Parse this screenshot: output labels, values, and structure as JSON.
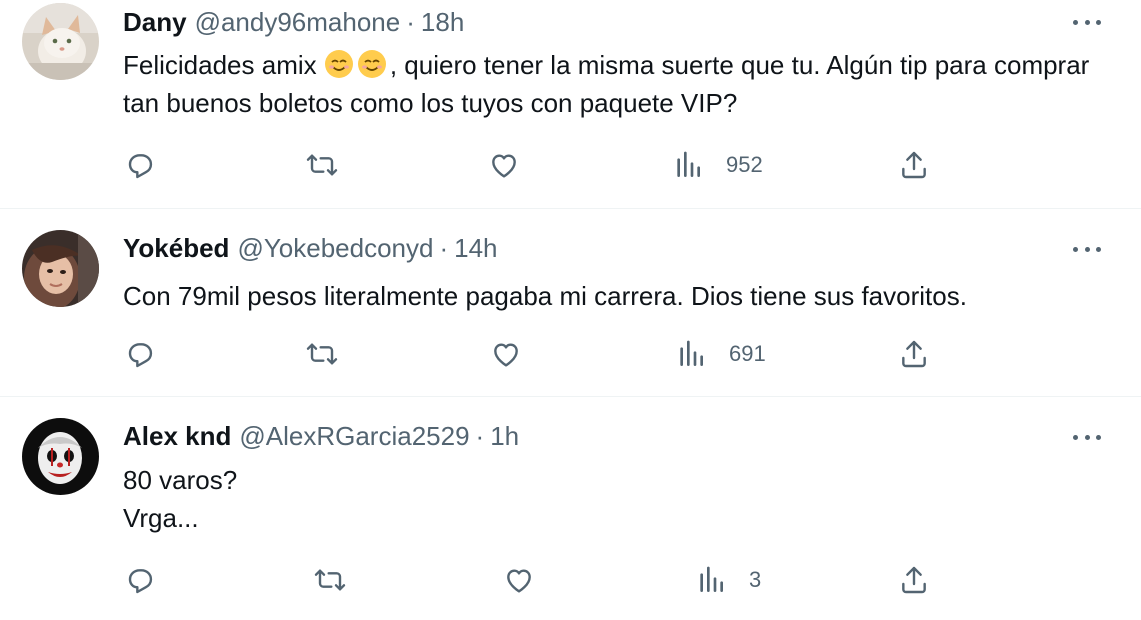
{
  "tweets": [
    {
      "name": "Dany",
      "handle": "@andy96mahone",
      "separator": "·",
      "time": "18h",
      "text_before_emoji": "Felicidades amix ",
      "emoji": [
        "smiling-face-with-hearts-emoji",
        "smiling-face-with-hearts-emoji"
      ],
      "text_after_emoji": ", quiero tener la misma suerte que tu. Algún tip para comprar tan buenos boletos como los tuyos con paquete VIP?",
      "views": "952",
      "avatar": "cat-photo-avatar"
    },
    {
      "name": "Yokébed",
      "handle": "@Yokebedconyd",
      "separator": "·",
      "time": "14h",
      "text": "Con 79mil pesos literalmente pagaba mi carrera. Dios tiene sus favoritos.",
      "views": "691",
      "avatar": "woman-photo-avatar"
    },
    {
      "name": "Alex knd",
      "handle": "@AlexRGarcia2529",
      "separator": "·",
      "time": "1h",
      "text_line1": "80 varos?",
      "text_line2": "Vrga...",
      "views": "3",
      "avatar": "clown-mask-avatar"
    }
  ],
  "colors": {
    "text": "#0f1419",
    "secondary": "#536471",
    "divider": "#eff3f4"
  },
  "icons": [
    "reply-icon",
    "retweet-icon",
    "like-icon",
    "views-icon",
    "share-icon",
    "more-icon"
  ]
}
